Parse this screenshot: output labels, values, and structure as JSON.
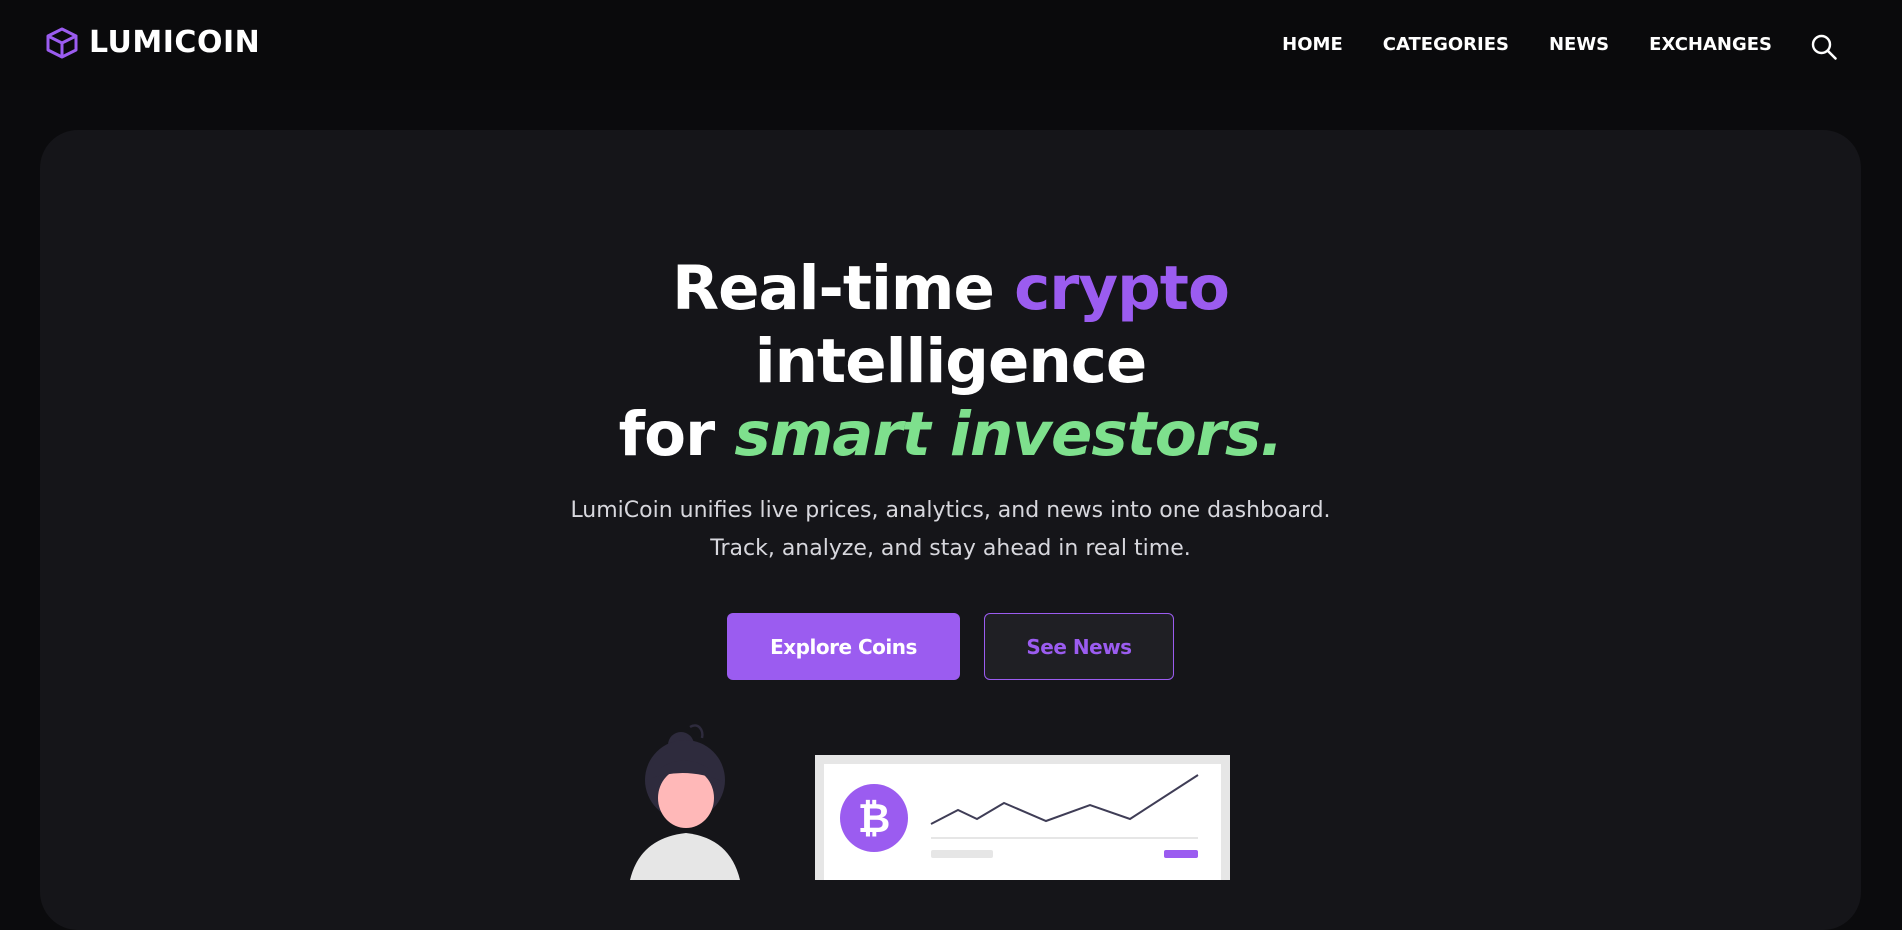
{
  "brand": {
    "name": "LUMICOIN",
    "accent": "#9b5cf0",
    "highlight": "#7ee08d"
  },
  "nav": {
    "items": [
      "HOME",
      "CATEGORIES",
      "NEWS",
      "EXCHANGES"
    ],
    "search_icon": "search-icon"
  },
  "hero": {
    "headline": {
      "line1_plain": "Real-time ",
      "line1_accent": "crypto",
      "line2": "intelligence",
      "line3_plain": "for ",
      "line3_accent": "smart investors."
    },
    "subtitle": {
      "line1": "LumiCoin unifies live prices, analytics, and news into one dashboard.",
      "line2": "Track, analyze, and stay ahead in real time."
    },
    "primary_button": "Explore Coins",
    "secondary_button": "See News"
  },
  "illustration": {
    "icons": [
      "person-illustration",
      "bitcoin-icon",
      "line-chart"
    ],
    "coin_symbol": "₿"
  }
}
